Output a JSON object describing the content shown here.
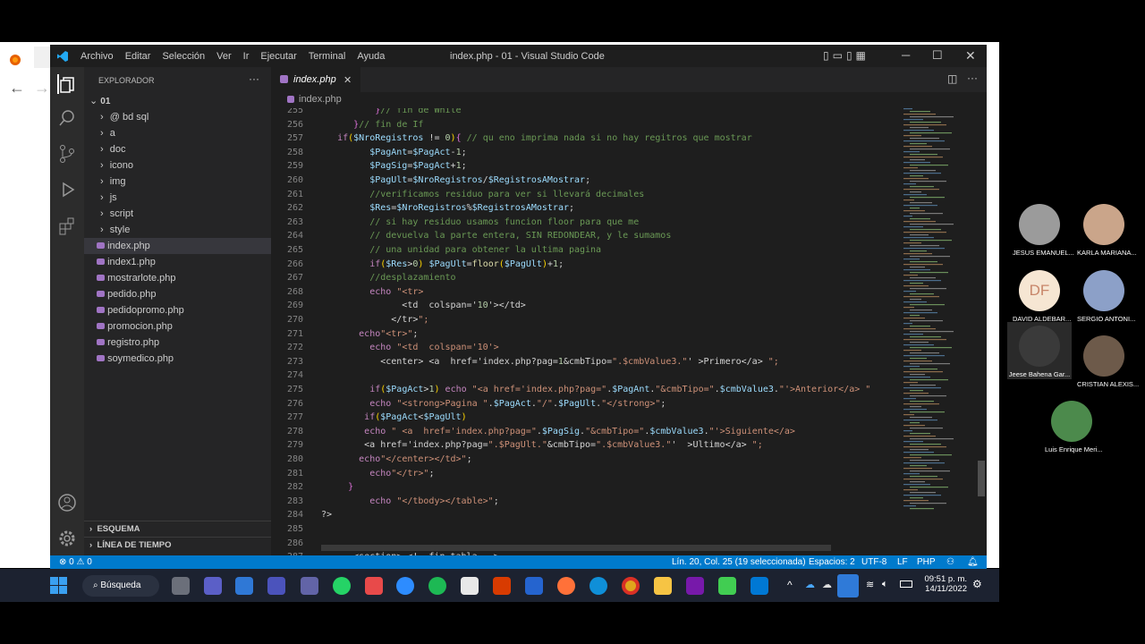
{
  "vscode": {
    "menu": [
      "Archivo",
      "Editar",
      "Selección",
      "Ver",
      "Ir",
      "Ejecutar",
      "Terminal",
      "Ayuda"
    ],
    "window_title": "index.php - 01 - Visual Studio Code",
    "explorer": {
      "title": "EXPLORADOR",
      "root": "01",
      "folders": [
        "@ bd sql",
        "a",
        "doc",
        "icono",
        "img",
        "js",
        "script",
        "style"
      ],
      "files": [
        "index.php",
        "index1.php",
        "mostrarlote.php",
        "pedido.php",
        "pedidopromo.php",
        "promocion.php",
        "registro.php",
        "soymedico.php"
      ],
      "selected": "index.php",
      "outline": "ESQUEMA",
      "timeline": "LÍNEA DE TIEMPO"
    },
    "tab": {
      "label": "index.php",
      "close": "✕"
    },
    "breadcrumb": "index.php",
    "code_lines": [
      {
        "n": "255",
        "t": "          }// fin de While"
      },
      {
        "n": "256",
        "t": "      }// fin de If"
      },
      {
        "n": "257",
        "t": "   if($NroRegistros != 0){ // qu eno imprima nada si no hay regitros que mostrar"
      },
      {
        "n": "258",
        "t": "         $PagAnt=$PagAct-1;"
      },
      {
        "n": "259",
        "t": "         $PagSig=$PagAct+1;"
      },
      {
        "n": "260",
        "t": "         $PagUlt=$NroRegistros/$RegistrosAMostrar;"
      },
      {
        "n": "261",
        "t": "         //verificamos residuo para ver si llevará decimales"
      },
      {
        "n": "262",
        "t": "         $Res=$NroRegistros%$RegistrosAMostrar;"
      },
      {
        "n": "263",
        "t": "         // si hay residuo usamos funcion floor para que me"
      },
      {
        "n": "264",
        "t": "         // devuelva la parte entera, SIN REDONDEAR, y le sumamos"
      },
      {
        "n": "265",
        "t": "         // una unidad para obtener la ultima pagina"
      },
      {
        "n": "266",
        "t": "         if($Res>0) $PagUlt=floor($PagUlt)+1;"
      },
      {
        "n": "267",
        "t": "         //desplazamiento"
      },
      {
        "n": "268",
        "t": "         echo \"<tr>"
      },
      {
        "n": "269",
        "t": "               <td  colspan='10'></td>"
      },
      {
        "n": "270",
        "t": "             </tr>\";"
      },
      {
        "n": "271",
        "t": "       echo\"<tr>\";"
      },
      {
        "n": "272",
        "t": "         echo \"<td  colspan='10'>"
      },
      {
        "n": "273",
        "t": "           <center> <a  href='index.php?pag=1&cmbTipo=\".$cmbValue3.\"' >Primero</a> \";"
      },
      {
        "n": "274",
        "t": ""
      },
      {
        "n": "275",
        "t": "         if($PagAct>1) echo \"<a href='index.php?pag=\".$PagAnt.\"&cmbTipo=\".$cmbValue3.\"'>Anterior</a> \""
      },
      {
        "n": "276",
        "t": "         echo \"<strong>Pagina \".$PagAct.\"/\".$PagUlt.\"</strong>\";"
      },
      {
        "n": "277",
        "t": "        if($PagAct<$PagUlt)"
      },
      {
        "n": "278",
        "t": "        echo \" <a  href='index.php?pag=\".$PagSig.\"&cmbTipo=\".$cmbValue3.\"'>Siguiente</a>"
      },
      {
        "n": "279",
        "t": "        <a href='index.php?pag=\".$PagUlt.\"&cmbTipo=\".$cmbValue3.\"'  >Ultimo</a> \";"
      },
      {
        "n": "280",
        "t": "       echo\"</center></td>\";"
      },
      {
        "n": "281",
        "t": "         echo\"</tr>\";"
      },
      {
        "n": "282",
        "t": "     }"
      },
      {
        "n": "283",
        "t": "         echo \"</tbody></table>\";"
      },
      {
        "n": "284",
        "t": "?>"
      },
      {
        "n": "285",
        "t": ""
      },
      {
        "n": "286",
        "t": ""
      },
      {
        "n": "287",
        "t": "      <section> <!- fin tabla -->"
      }
    ],
    "status": {
      "problems": "⊗ 0 ⚠ 0",
      "position": "Lín. 20, Col. 25 (19 seleccionada)",
      "spaces": "Espacios: 2",
      "encoding": "UTF-8",
      "eol": "LF",
      "language": "PHP"
    }
  },
  "taskbar": {
    "search": "Búsqueda",
    "time": "09:51 p. m.",
    "date": "14/11/2022"
  },
  "participants": [
    {
      "name": "JESUS EMANUEL...",
      "initials": ""
    },
    {
      "name": "KARLA MARIANA...",
      "initials": ""
    },
    {
      "name": "DAVID ALDEBAR...",
      "initials": "DF"
    },
    {
      "name": "SERGIO ANTONI...",
      "initials": ""
    },
    {
      "name": "Jeese Bahena Gar...",
      "initials": ""
    },
    {
      "name": "CRISTIAN ALEXIS...",
      "initials": ""
    },
    {
      "name": "Luis Enrique Meri...",
      "initials": ""
    }
  ],
  "colors": {
    "accent": "#007acc",
    "editor_bg": "#1e1e1e",
    "sidebar_bg": "#252526",
    "php_icon": "#a074c4"
  }
}
